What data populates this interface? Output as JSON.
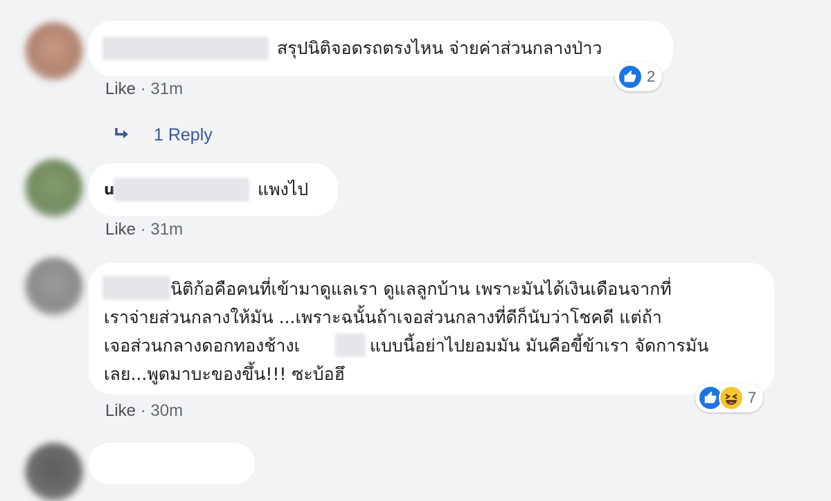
{
  "comments": [
    {
      "text_lines": [
        "สรุปนิติจอดรถตรงไหน จ่ายค่าส่วนกลางป่าว"
      ],
      "reaction_count": "2",
      "like_label": "Like",
      "separator": "·",
      "time": "31m"
    },
    {
      "name_prefix": "u",
      "text_lines": [
        "แพงไป"
      ],
      "like_label": "Like",
      "separator": "·",
      "time": "31m"
    },
    {
      "text_lines": [
        "นิติก้อคือคนที่เข้ามาดูแลเรา ดูแลลูกบ้าน เพราะมันได้เงินเดือนจากที่",
        "เราจ่ายส่วนกลางให้มัน ...เพราะฉนั้นถ้าเจอส่วนกลางที่ดีก็นับว่าโชคดี แต่ถ้า",
        "เจอส่วนกลางดอกทองช้างเ",
        "แบบนี้อย่าไปยอมมัน มันคือขี้ข้าเรา จัดการมัน",
        "เลย...พูดมาบะของขึ้น!!! ซะบ้อฮึ"
      ],
      "reaction_count": "7",
      "like_label": "Like",
      "separator": "·",
      "time": "30m"
    }
  ],
  "reply_link": {
    "label": "1 Reply",
    "icon": "reply-arrow-icon"
  },
  "colors": {
    "background": "#f2f3f5",
    "bubble": "#ffffff",
    "link": "#385898",
    "meta": "#606770",
    "like_reaction": "#1b74e4",
    "haha_reaction": "#f7c531"
  }
}
